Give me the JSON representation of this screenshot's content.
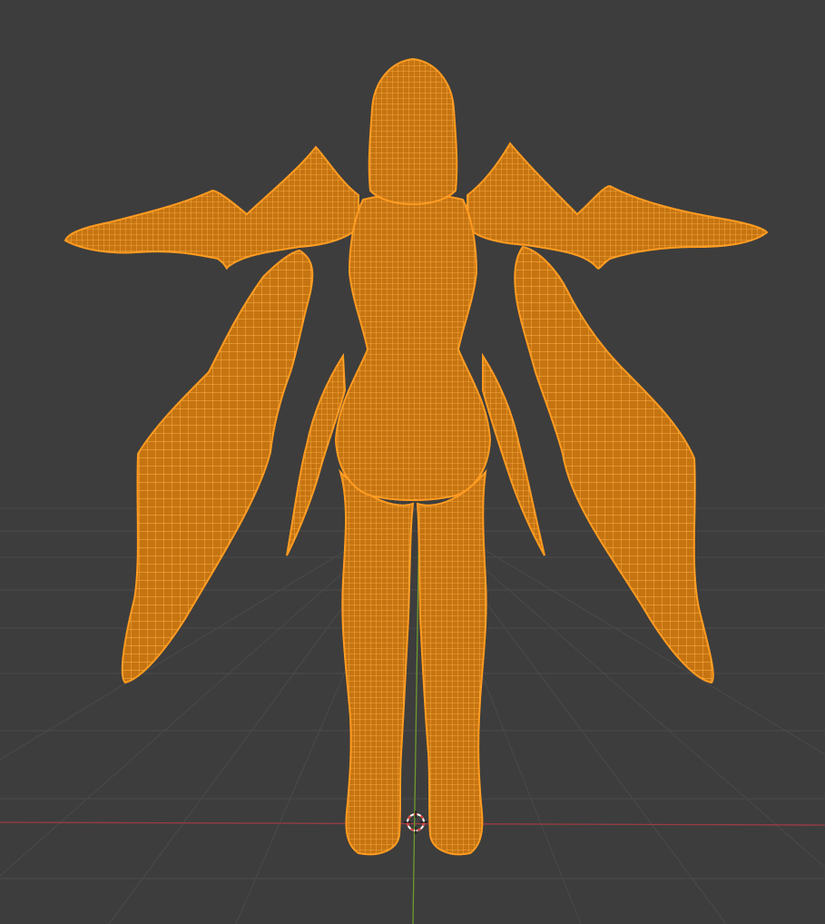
{
  "viewport": {
    "mode": "edit-mode-wireframe",
    "background_color": "#3d3d3d",
    "grid_color": "#4a4a4a",
    "x_axis_color": "#9c3c44",
    "y_axis_color": "#6f9a2c",
    "selection_color": "#ff9a1f",
    "selection_fill": "#c06e12",
    "wire_color": "#ffb040"
  },
  "mesh": {
    "name": "",
    "selected": true,
    "parts": [
      "head",
      "torso",
      "left-arm",
      "right-arm",
      "left-wing",
      "right-wing",
      "left-leg",
      "right-leg",
      "left-hip-blade",
      "right-hip-blade"
    ]
  },
  "cursor_3d": {
    "icon": "crosshair-cursor-icon"
  }
}
